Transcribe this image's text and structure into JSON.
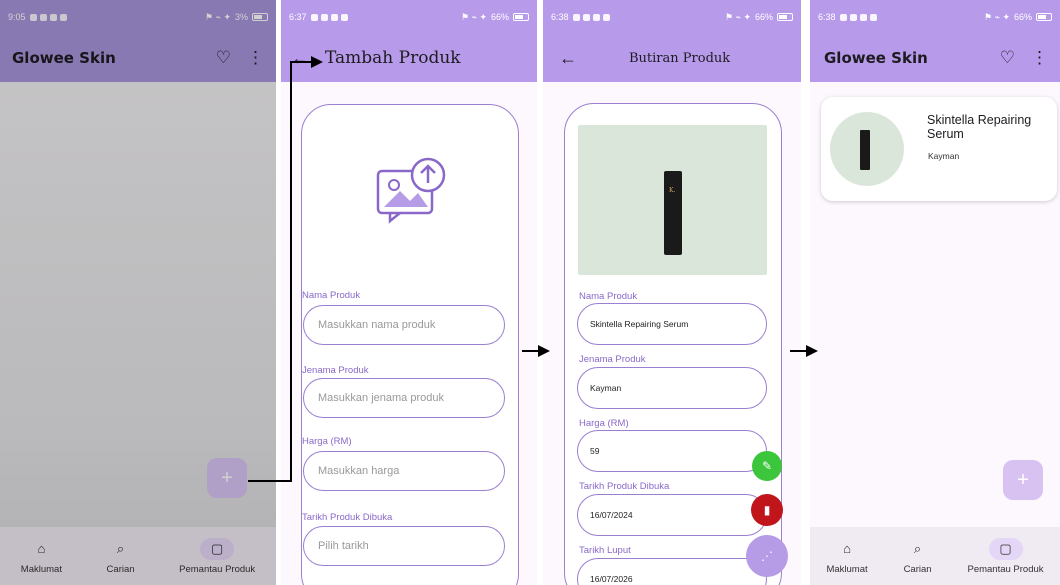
{
  "panels": {
    "home_empty": {
      "status": {
        "time": "9:05",
        "battery": "3%"
      },
      "title": "Glowee Skin",
      "fab_label": "+",
      "nav": [
        {
          "label": "Maklumat",
          "icon": "home-icon"
        },
        {
          "label": "Carian",
          "icon": "search-icon"
        },
        {
          "label": "Pemantau Produk",
          "icon": "save-icon",
          "active": true
        }
      ]
    },
    "add_product": {
      "status": {
        "time": "6:37",
        "battery": "66%"
      },
      "back": "←",
      "title": "Tambah Produk",
      "image_upload_icon": "image-upload-icon",
      "fields": [
        {
          "label": "Nama Produk",
          "placeholder": "Masukkan nama produk"
        },
        {
          "label": "Jenama Produk",
          "placeholder": "Masukkan jenama produk"
        },
        {
          "label": "Harga (RM)",
          "placeholder": "Masukkan harga"
        },
        {
          "label": "Tarikh Produk Dibuka",
          "placeholder": "Pilih tarikh"
        }
      ]
    },
    "product_detail": {
      "status": {
        "time": "6:38",
        "battery": "66%"
      },
      "back": "←",
      "title": "Butiran Produk",
      "bottle_brand": "K.",
      "fields": [
        {
          "label": "Nama Produk",
          "value": "Skintella Repairing Serum"
        },
        {
          "label": "Jenama Produk",
          "value": "Kayman"
        },
        {
          "label": "Harga (RM)",
          "value": "59"
        },
        {
          "label": "Tarikh Produk Dibuka",
          "value": "16/07/2024"
        },
        {
          "label": "Tarikh Luput",
          "value": "16/07/2026"
        }
      ],
      "colors": {
        "edit": "#3cc63c",
        "delete": "#c0151b",
        "menu": "#b69be6"
      }
    },
    "home_list": {
      "status": {
        "time": "6:38",
        "battery": "66%"
      },
      "title": "Glowee Skin",
      "product": {
        "name": "Skintella Repairing Serum",
        "brand": "Kayman"
      },
      "fab_label": "+",
      "nav": [
        {
          "label": "Maklumat",
          "icon": "home-icon"
        },
        {
          "label": "Carian",
          "icon": "search-icon"
        },
        {
          "label": "Pemantau Produk",
          "icon": "save-icon",
          "active": true
        }
      ]
    }
  },
  "watermark": "CO",
  "colors": {
    "accent": "#b79bea",
    "outline": "#9b7fd0",
    "label": "#8a68c9",
    "background": "#fdf7fe"
  }
}
